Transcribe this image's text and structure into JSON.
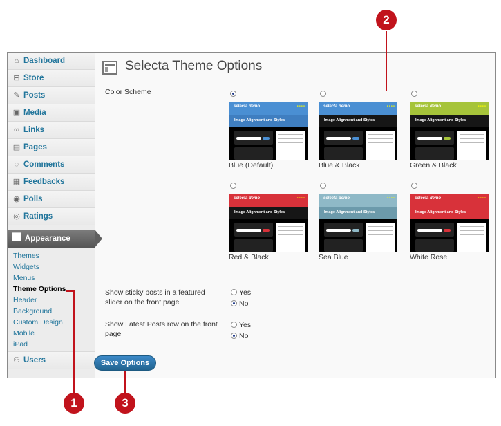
{
  "nav": {
    "top_items": [
      {
        "label": "Dashboard",
        "icon": "house-icon"
      },
      {
        "label": "Store",
        "icon": "cart-icon"
      },
      {
        "label": "Posts",
        "icon": "pin-icon"
      },
      {
        "label": "Media",
        "icon": "media-icon"
      },
      {
        "label": "Links",
        "icon": "link-icon"
      },
      {
        "label": "Pages",
        "icon": "pages-icon"
      },
      {
        "label": "Comments",
        "icon": "comment-icon"
      },
      {
        "label": "Feedbacks",
        "icon": "feedback-icon"
      },
      {
        "label": "Polls",
        "icon": "polls-icon"
      },
      {
        "label": "Ratings",
        "icon": "ratings-icon"
      }
    ],
    "appearance": "Appearance",
    "sub_items": [
      "Themes",
      "Widgets",
      "Menus",
      "Theme Options",
      "Header",
      "Background",
      "Custom Design",
      "Mobile",
      "iPad"
    ],
    "current_sub": "Theme Options",
    "users": "Users"
  },
  "page": {
    "title": "Selecta Theme Options",
    "color_scheme_label": "Color Scheme",
    "schemes": [
      {
        "name": "Blue (Default)",
        "selected": true,
        "accent": "#4a8fd3",
        "bar2": "#3f7ec0"
      },
      {
        "name": "Blue & Black",
        "selected": false,
        "accent": "#4a8fd3",
        "bar2": "#161616"
      },
      {
        "name": "Green & Black",
        "selected": false,
        "accent": "#a6c43a",
        "bar2": "#161616"
      },
      {
        "name": "Red & Black",
        "selected": false,
        "accent": "#d8323a",
        "bar2": "#161616"
      },
      {
        "name": "Sea Blue",
        "selected": false,
        "accent": "#8fb9c7",
        "bar2": "#6c9aab"
      },
      {
        "name": "White Rose",
        "selected": false,
        "accent": "#d8323a",
        "bar2": "#d8323a"
      }
    ],
    "thumb_demo_title": "selecta demo",
    "thumb_section": "Image Alignment and Styles",
    "sticky_label": "Show sticky posts in a featured slider on the front page",
    "sticky_options": [
      {
        "label": "Yes",
        "checked": false
      },
      {
        "label": "No",
        "checked": true
      }
    ],
    "latest_label": "Show Latest Posts row on the front page",
    "latest_options": [
      {
        "label": "Yes",
        "checked": false
      },
      {
        "label": "No",
        "checked": true
      }
    ],
    "save_label": "Save Options"
  },
  "callouts": [
    "1",
    "2",
    "3"
  ]
}
